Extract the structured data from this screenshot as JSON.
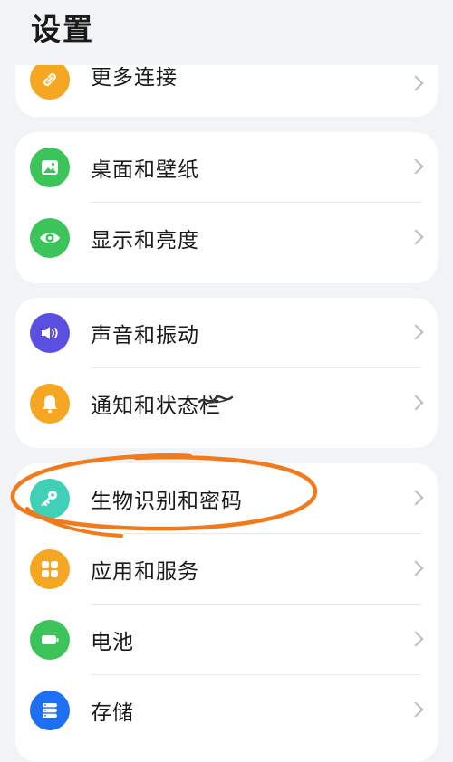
{
  "header": {
    "title": "设置"
  },
  "colors": {
    "accent_annotation": "#f07a1c",
    "orange": "#f5a623",
    "green": "#3cc45a",
    "purple": "#5a4fe0",
    "teal": "#3fd0b6",
    "blue": "#1f6ff2"
  },
  "groups": [
    {
      "items": [
        {
          "label": "更多连接",
          "icon": "link-icon"
        }
      ]
    },
    {
      "items": [
        {
          "label": "桌面和壁纸",
          "icon": "image-icon"
        },
        {
          "label": "显示和亮度",
          "icon": "eye-icon"
        }
      ]
    },
    {
      "items": [
        {
          "label": "声音和振动",
          "icon": "speaker-icon"
        },
        {
          "label": "通知和状态栏",
          "icon": "bell-icon"
        }
      ]
    },
    {
      "items": [
        {
          "label": "生物识别和密码",
          "icon": "key-icon"
        },
        {
          "label": "应用和服务",
          "icon": "apps-grid-icon"
        },
        {
          "label": "电池",
          "icon": "battery-icon"
        },
        {
          "label": "存储",
          "icon": "storage-icon"
        }
      ]
    }
  ]
}
